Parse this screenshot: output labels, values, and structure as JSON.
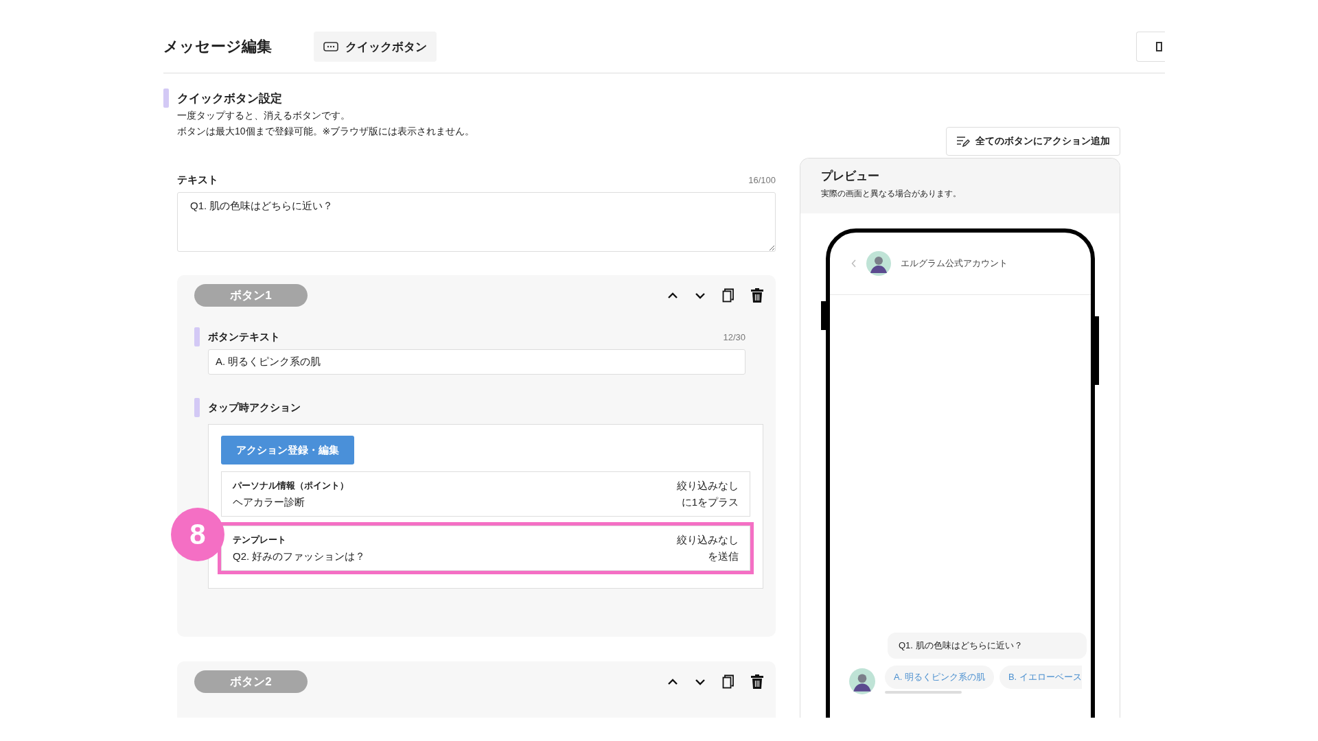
{
  "header": {
    "title": "メッセージ編集",
    "type_chip": "クイックボタン"
  },
  "section": {
    "title": "クイックボタン設定",
    "description": [
      "一度タップすると、消えるボタンです。",
      "ボタンは最大10個まで登録可能。※ブラウザ版には表示されません。"
    ],
    "add_action_all_button": "全てのボタンにアクション追加"
  },
  "text_field": {
    "label": "テキスト",
    "counter": "16/100",
    "value": "Q1. 肌の色味はどちらに近い？"
  },
  "buttons": [
    {
      "title": "ボタン1",
      "text_label": "ボタンテキスト",
      "counter": "12/30",
      "value": "A. 明るくピンク系の肌",
      "action_label": "タップ時アクション",
      "action_button": "アクション登録・編集",
      "actions": [
        {
          "type": "パーソナル情報（ポイント）",
          "detail": "ヘアカラー診断",
          "condition": "絞り込みなし",
          "effect": "に1をプラス",
          "highlighted": false
        },
        {
          "type": "テンプレート",
          "detail": "Q2. 好みのファッションは？",
          "condition": "絞り込みなし",
          "effect": "を送信",
          "highlighted": true,
          "callout": "8"
        }
      ]
    },
    {
      "title": "ボタン2"
    }
  ],
  "preview": {
    "title": "プレビュー",
    "note": "実際の画面と異なる場合があります。",
    "account_name": "エルグラム公式アカウント",
    "message": "Q1. 肌の色味はどちらに近い？",
    "quick_replies": [
      "A. 明るくピンク系の肌",
      "B. イエローベース"
    ]
  }
}
